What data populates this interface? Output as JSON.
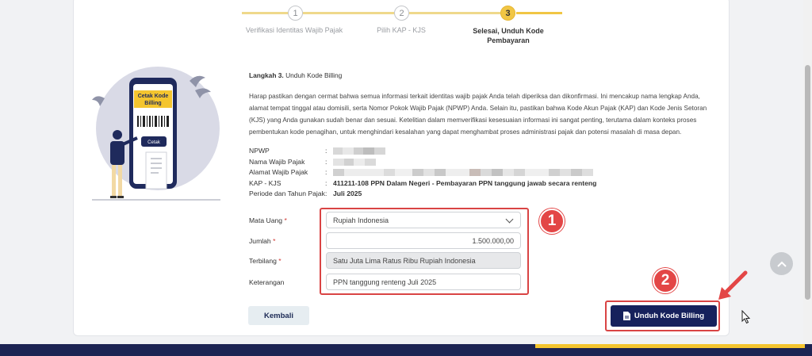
{
  "stepper": {
    "steps": [
      {
        "number": "1",
        "label": "Verifikasi Identitas Wajib Pajak"
      },
      {
        "number": "2",
        "label": "Pilih KAP - KJS"
      },
      {
        "number": "3",
        "label_line1": "Selesai, Unduh Kode",
        "label_line2": "Pembayaran"
      }
    ]
  },
  "illustration": {
    "phone_banner": "Cetak Kode",
    "phone_banner_2": "Billing",
    "phone_button": "Cetak"
  },
  "content": {
    "step_prefix": "Langkah 3.",
    "step_title": "Unduh Kode Billing",
    "description": "Harap pastikan dengan cermat bahwa semua informasi terkait identitas wajib pajak Anda telah diperiksa dan dikonfirmasi. Ini mencakup nama lengkap Anda, alamat tempat tinggal atau domisili, serta Nomor Pokok Wajib Pajak (NPWP) Anda. Selain itu, pastikan bahwa Kode Akun Pajak (KAP) dan Kode Jenis Setoran (KJS) yang Anda gunakan sudah benar dan sesuai. Ketelitian dalam memverifikasi kesesuaian informasi ini sangat penting, terutama dalam konteks proses pembentukan kode penagihan, untuk menghindari kesalahan yang dapat menghambat proses administrasi pajak dan potensi masalah di masa depan."
  },
  "info": {
    "npwp_label": "NPWP",
    "nama_label": "Nama Wajib Pajak",
    "alamat_label": "Alamat Wajib Pajak",
    "kap_label": "KAP - KJS",
    "kap_value": "411211-108 PPN Dalam Negeri - Pembayaran PPN tanggung jawab secara renteng",
    "periode_label": "Periode dan Tahun Pajak",
    "periode_value": "Juli 2025",
    "colon": ":"
  },
  "form": {
    "mata_uang_label": "Mata Uang",
    "mata_uang_value": "Rupiah Indonesia",
    "jumlah_label": "Jumlah",
    "jumlah_value": "1.500.000,00",
    "terbilang_label": "Terbilang",
    "terbilang_value": "Satu Juta Lima Ratus Ribu Rupiah Indonesia",
    "keterangan_label": "Keterangan",
    "keterangan_value": "PPN tanggung renteng Juli 2025",
    "required_mark": "*"
  },
  "buttons": {
    "back": "Kembali",
    "download": "Unduh Kode Billing"
  },
  "annotations": {
    "badge_1": "1",
    "badge_2": "2"
  },
  "colors": {
    "accent_yellow": "#f1c644",
    "primary_navy": "#16215c",
    "annotation_red": "#e34646"
  }
}
